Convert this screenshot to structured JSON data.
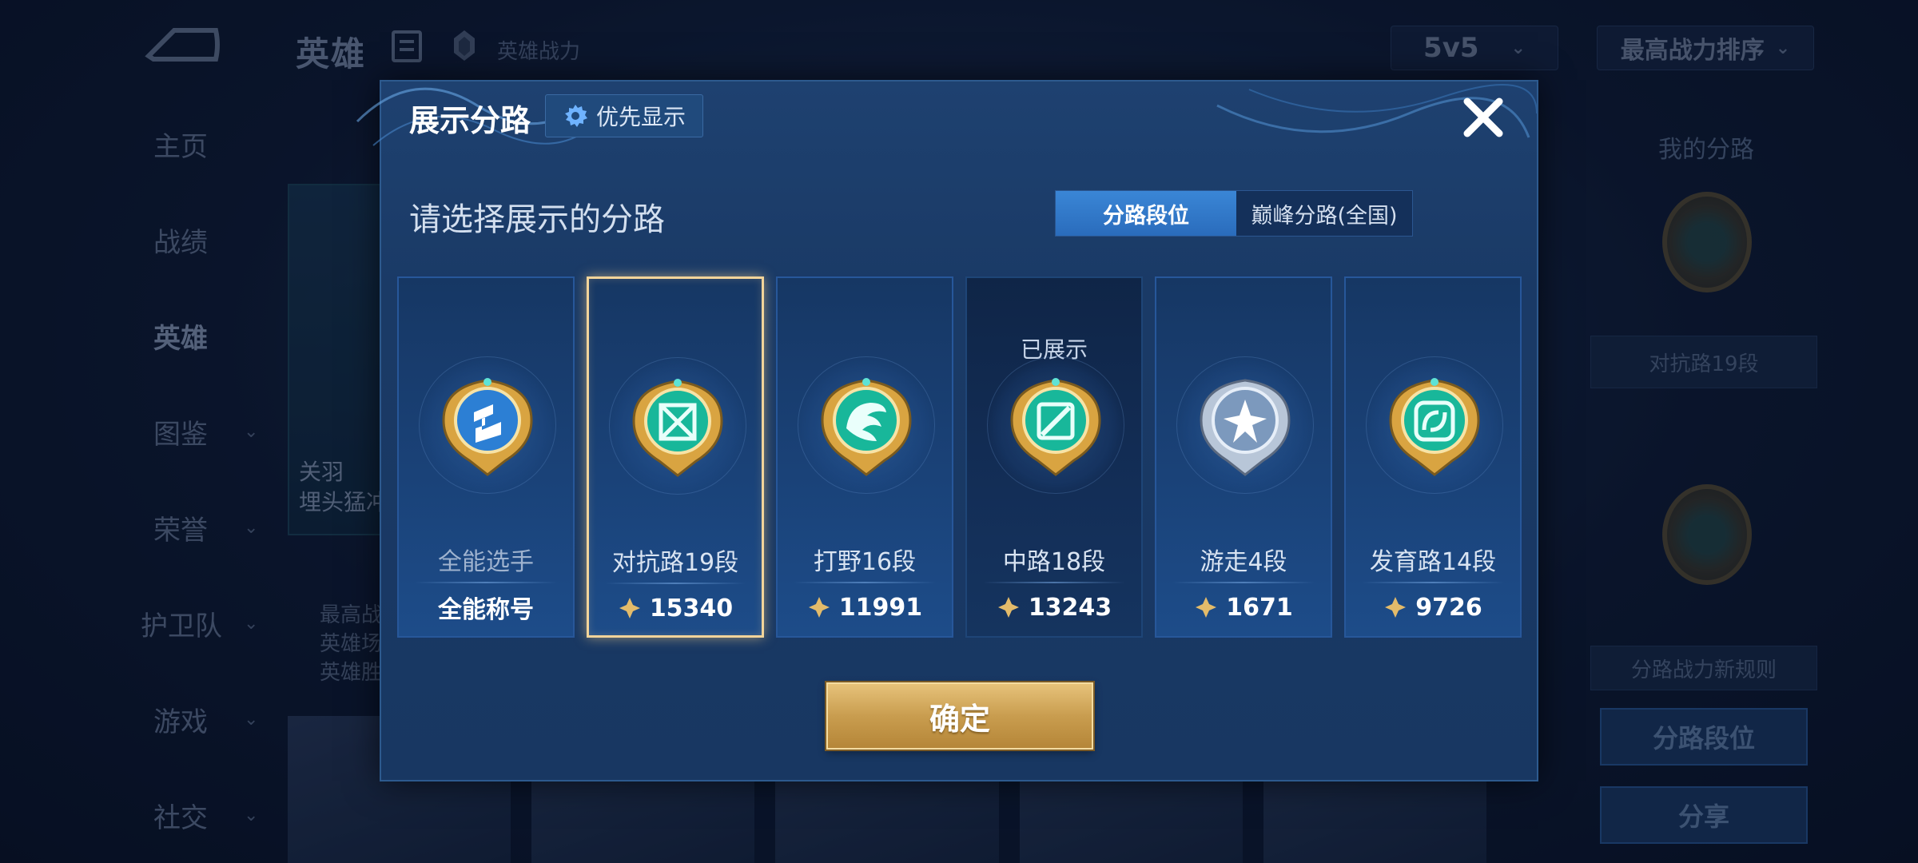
{
  "background": {
    "header": {
      "title": "英雄",
      "power_label": "英雄战力",
      "mode_select": "5v5",
      "sort_select": "最高战力排序"
    },
    "sidebar": {
      "items": [
        {
          "label": "主页",
          "has_arrow": false
        },
        {
          "label": "战绩",
          "has_arrow": false
        },
        {
          "label": "英雄",
          "has_arrow": false,
          "active": true
        },
        {
          "label": "图鉴",
          "has_arrow": true
        },
        {
          "label": "荣誉",
          "has_arrow": true
        },
        {
          "label": "护卫队",
          "has_arrow": true
        },
        {
          "label": "游戏",
          "has_arrow": true
        },
        {
          "label": "社交",
          "has_arrow": true
        }
      ]
    },
    "hero_card": {
      "name_line1": "关羽",
      "name_line2": "埋头猛冲",
      "stats": [
        "最高战",
        "英雄场",
        "英雄胜"
      ]
    },
    "right_panel": {
      "title": "我的分路",
      "chip": "对抗路19段",
      "rule_chip": "分路战力新规则",
      "lane_rank_button": "分路段位",
      "share_button": "分享"
    }
  },
  "modal": {
    "title": "展示分路",
    "priority_button": "优先显示",
    "select_title": "请选择展示的分路",
    "segment": {
      "active": "分路段位",
      "inactive": "巅峰分路(全国)"
    },
    "cards": [
      {
        "role": "全能选手",
        "score": "全能称号",
        "shown": "",
        "has_power_icon": false,
        "selected": false,
        "dark": false,
        "badge": "all-round-badge"
      },
      {
        "role": "对抗路19段",
        "score": "15340",
        "shown": "",
        "has_power_icon": true,
        "selected": true,
        "dark": false,
        "badge": "clash-lane-badge"
      },
      {
        "role": "打野16段",
        "score": "11991",
        "shown": "",
        "has_power_icon": true,
        "selected": false,
        "dark": false,
        "badge": "jungle-badge"
      },
      {
        "role": "中路18段",
        "score": "13243",
        "shown": "已展示",
        "has_power_icon": true,
        "selected": false,
        "dark": true,
        "badge": "mid-lane-badge"
      },
      {
        "role": "游走4段",
        "score": "1671",
        "shown": "",
        "has_power_icon": true,
        "selected": false,
        "dark": false,
        "badge": "roam-badge"
      },
      {
        "role": "发育路14段",
        "score": "9726",
        "shown": "",
        "has_power_icon": true,
        "selected": false,
        "dark": false,
        "badge": "farm-lane-badge"
      }
    ],
    "confirm_button": "确定"
  },
  "colors": {
    "modal_bg": "#1e4170",
    "accent_blue": "#3a86d6",
    "gold": "#e6c27a",
    "selected_border": "#f2d49a"
  }
}
